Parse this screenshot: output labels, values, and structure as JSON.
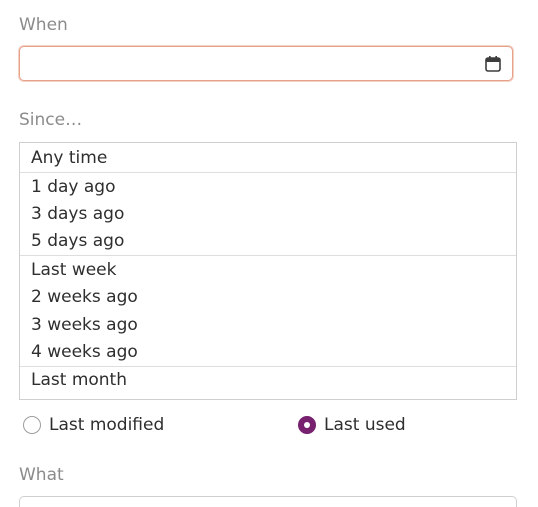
{
  "when": {
    "label": "When",
    "date_value": "",
    "icon": "calendar-icon"
  },
  "since": {
    "label": "Since…",
    "items": [
      {
        "label": "Any time"
      },
      {
        "label": "1 day ago"
      },
      {
        "label": "3 days ago"
      },
      {
        "label": "5 days ago"
      },
      {
        "label": "Last week"
      },
      {
        "label": "2 weeks ago"
      },
      {
        "label": "3 weeks ago"
      },
      {
        "label": "4 weeks ago"
      },
      {
        "label": "Last month"
      }
    ]
  },
  "time_type": {
    "options": [
      {
        "label": "Last modified",
        "checked": false
      },
      {
        "label": "Last used",
        "checked": true
      }
    ],
    "accent_color": "#77216f"
  },
  "what": {
    "label": "What"
  },
  "colors": {
    "focus_border": "#e9a28a",
    "label_gray": "#8b8b8b"
  }
}
